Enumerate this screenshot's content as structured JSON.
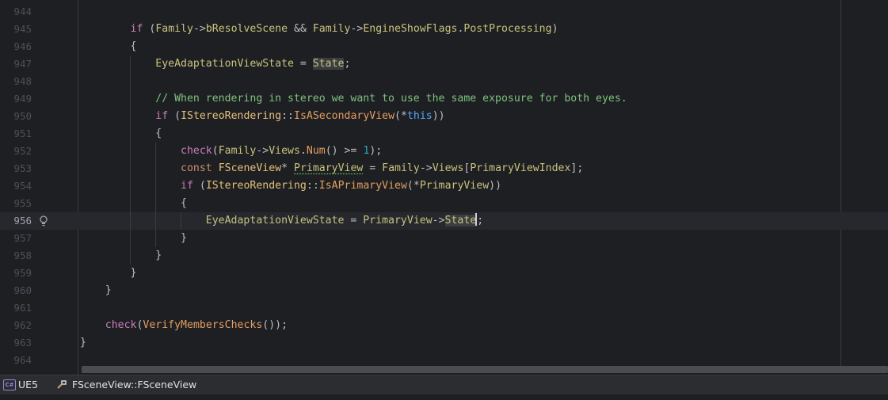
{
  "editor": {
    "lines": [
      {
        "num": "944",
        "tokens": []
      },
      {
        "num": "945",
        "tokens": [
          {
            "t": "        "
          },
          {
            "t": "if",
            "c": "ctrl"
          },
          {
            "t": " ("
          },
          {
            "t": "Family",
            "c": "field"
          },
          {
            "t": "->"
          },
          {
            "t": "bResolveScene",
            "c": "field"
          },
          {
            "t": " && "
          },
          {
            "t": "Family",
            "c": "field"
          },
          {
            "t": "->"
          },
          {
            "t": "EngineShowFlags",
            "c": "field"
          },
          {
            "t": "."
          },
          {
            "t": "PostProcessing",
            "c": "field"
          },
          {
            "t": ")"
          }
        ]
      },
      {
        "num": "946",
        "tokens": [
          {
            "t": "        {"
          }
        ]
      },
      {
        "num": "947",
        "tokens": [
          {
            "t": "            "
          },
          {
            "t": "EyeAdaptationViewState",
            "c": "field"
          },
          {
            "t": " = "
          },
          {
            "t": "State",
            "c": "field",
            "hl": true
          },
          {
            "t": ";"
          }
        ]
      },
      {
        "num": "948",
        "tokens": []
      },
      {
        "num": "949",
        "tokens": [
          {
            "t": "            "
          },
          {
            "t": "// When rendering in stereo we want to use the same exposure for both eyes.",
            "c": "comment"
          }
        ]
      },
      {
        "num": "950",
        "tokens": [
          {
            "t": "            "
          },
          {
            "t": "if",
            "c": "ctrl"
          },
          {
            "t": " ("
          },
          {
            "t": "IStereoRendering",
            "c": "ns"
          },
          {
            "t": "::"
          },
          {
            "t": "IsASecondaryView",
            "c": "fn"
          },
          {
            "t": "(*"
          },
          {
            "t": "this",
            "c": "this"
          },
          {
            "t": "))"
          }
        ]
      },
      {
        "num": "951",
        "tokens": [
          {
            "t": "            {"
          }
        ]
      },
      {
        "num": "952",
        "tokens": [
          {
            "t": "                "
          },
          {
            "t": "check",
            "c": "ctrl"
          },
          {
            "t": "("
          },
          {
            "t": "Family",
            "c": "field"
          },
          {
            "t": "->"
          },
          {
            "t": "Views",
            "c": "field"
          },
          {
            "t": "."
          },
          {
            "t": "Num",
            "c": "fn"
          },
          {
            "t": "() >= "
          },
          {
            "t": "1",
            "c": "num"
          },
          {
            "t": ");"
          }
        ]
      },
      {
        "num": "953",
        "tokens": [
          {
            "t": "                "
          },
          {
            "t": "const",
            "c": "kw"
          },
          {
            "t": " "
          },
          {
            "t": "FSceneView",
            "c": "ns"
          },
          {
            "t": "* "
          },
          {
            "t": "PrimaryView",
            "c": "field",
            "squig": true
          },
          {
            "t": " = "
          },
          {
            "t": "Family",
            "c": "field"
          },
          {
            "t": "->"
          },
          {
            "t": "Views",
            "c": "field"
          },
          {
            "t": "["
          },
          {
            "t": "PrimaryViewIndex",
            "c": "field"
          },
          {
            "t": "];"
          }
        ]
      },
      {
        "num": "954",
        "tokens": [
          {
            "t": "                "
          },
          {
            "t": "if",
            "c": "ctrl"
          },
          {
            "t": " ("
          },
          {
            "t": "IStereoRendering",
            "c": "ns"
          },
          {
            "t": "::"
          },
          {
            "t": "IsAPrimaryView",
            "c": "fn"
          },
          {
            "t": "(*"
          },
          {
            "t": "PrimaryView",
            "c": "field"
          },
          {
            "t": "))"
          }
        ]
      },
      {
        "num": "955",
        "tokens": [
          {
            "t": "                {"
          }
        ]
      },
      {
        "num": "956",
        "current": true,
        "tokens": [
          {
            "t": "                    "
          },
          {
            "t": "EyeAdaptationViewState",
            "c": "field"
          },
          {
            "t": " = "
          },
          {
            "t": "PrimaryView",
            "c": "field"
          },
          {
            "t": "->"
          },
          {
            "t": "State",
            "c": "field",
            "hl": true
          },
          {
            "t": ";",
            "caret": true
          }
        ]
      },
      {
        "num": "957",
        "tokens": [
          {
            "t": "                }"
          }
        ]
      },
      {
        "num": "958",
        "tokens": [
          {
            "t": "            }"
          }
        ]
      },
      {
        "num": "959",
        "tokens": [
          {
            "t": "        }"
          }
        ]
      },
      {
        "num": "960",
        "tokens": [
          {
            "t": "    }"
          }
        ]
      },
      {
        "num": "961",
        "tokens": []
      },
      {
        "num": "962",
        "tokens": [
          {
            "t": "    "
          },
          {
            "t": "check",
            "c": "ctrl"
          },
          {
            "t": "("
          },
          {
            "t": "VerifyMembersChecks",
            "c": "fn"
          },
          {
            "t": "());"
          }
        ]
      },
      {
        "num": "963",
        "tokens": [
          {
            "t": "}"
          }
        ]
      },
      {
        "num": "964",
        "tokens": []
      }
    ]
  },
  "statusbar": {
    "project_badge": "C#",
    "project_name": "UE5",
    "context_label": "FSceneView::FSceneView"
  },
  "colors": {
    "background": "#1e1f22",
    "current_line": "#26282e",
    "comment": "#7ec27e",
    "control_keyword": "#c77dbb",
    "field": "#c9c27f"
  },
  "icons": {
    "gutter": "lightbulb-icon",
    "project": "csharp-project-icon",
    "context": "method-icon"
  }
}
